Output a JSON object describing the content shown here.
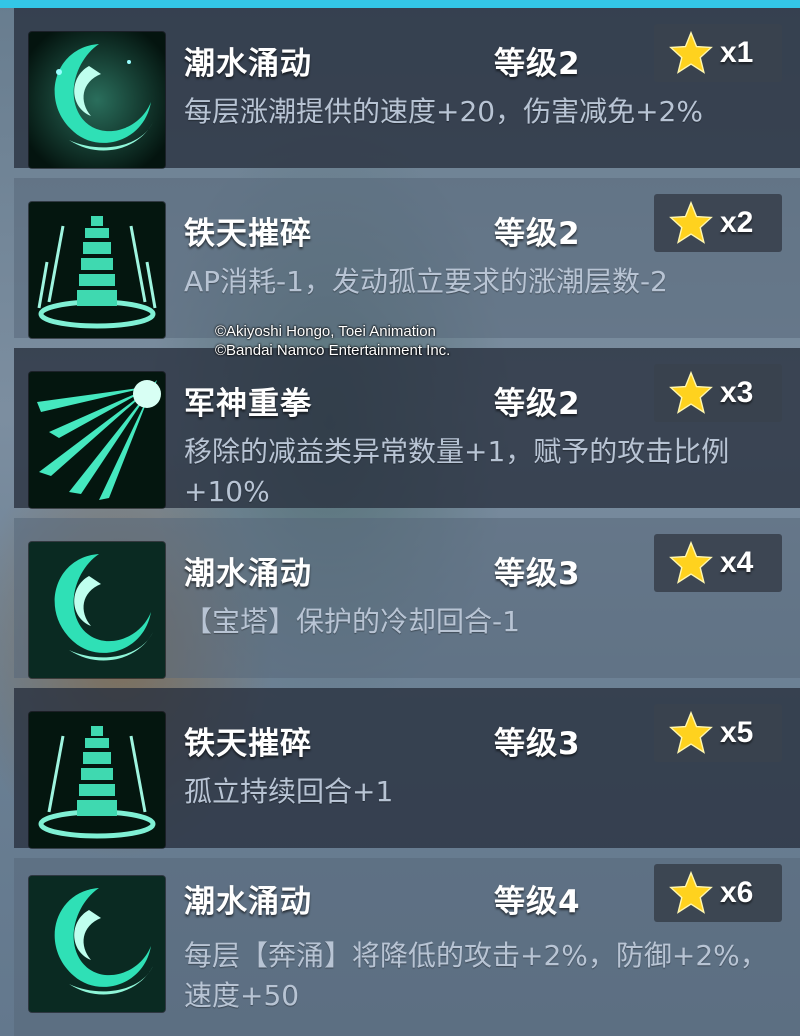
{
  "copyright": {
    "line1": "©Akiyoshi Hongo, Toei Animation",
    "line2": "©Bandai Namco Entertainment Inc."
  },
  "accent_color": "#33c6e6",
  "star_color": "#ffd21e",
  "skills": [
    {
      "name": "潮水涌动",
      "level": "等级2",
      "count": "x1",
      "icon": "tide-swirl-icon",
      "desc": "每层涨潮提供的速度+20，伤害减免+2%"
    },
    {
      "name": "铁天摧碎",
      "level": "等级2",
      "count": "x2",
      "icon": "pagoda-burst-icon",
      "desc": "AP消耗-1，发动孤立要求的涨潮层数-2"
    },
    {
      "name": "军神重拳",
      "level": "等级2",
      "count": "x3",
      "icon": "punch-burst-icon",
      "desc": "移除的减益类异常数量+1，赋予的攻击比例+10%"
    },
    {
      "name": "潮水涌动",
      "level": "等级3",
      "count": "x4",
      "icon": "tide-swirl-icon",
      "desc": "【宝塔】保护的冷却回合-1"
    },
    {
      "name": "铁天摧碎",
      "level": "等级3",
      "count": "x5",
      "icon": "pagoda-burst-icon",
      "desc": "孤立持续回合+1"
    },
    {
      "name": "潮水涌动",
      "level": "等级4",
      "count": "x6",
      "icon": "tide-swirl-icon",
      "desc": "每层【奔涌】将降低的攻击+2%，防御+2%，速度+50"
    }
  ]
}
